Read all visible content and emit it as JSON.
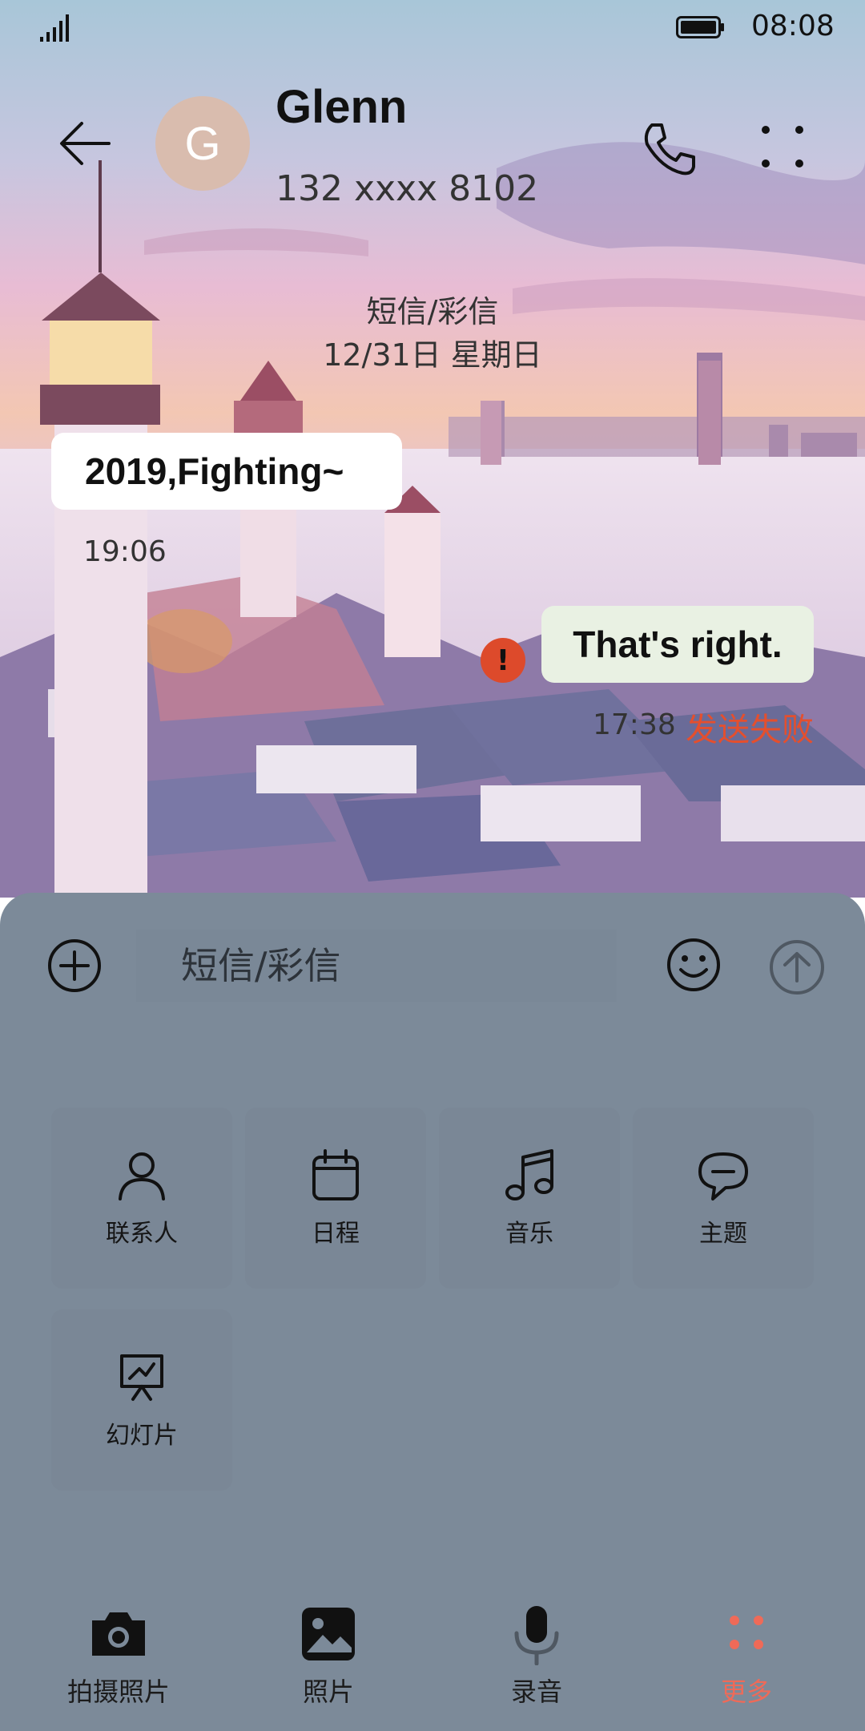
{
  "status_bar": {
    "time": "08:08",
    "signal_icon": "signal-icon",
    "battery_icon": "battery-icon"
  },
  "header": {
    "back_icon": "back-arrow-icon",
    "avatar_letter": "G",
    "name": "Glenn",
    "phone": "132 xxxx 8102",
    "call_icon": "phone-icon",
    "more_icon": "more-icon"
  },
  "conversation": {
    "type_label": "短信/彩信",
    "date": "12/31日 星期日",
    "messages": [
      {
        "direction": "incoming",
        "text": "2019,Fighting~",
        "time": "19:06"
      },
      {
        "direction": "outgoing",
        "text": "That's right.",
        "time": "17:38",
        "status": "发送失败",
        "error_mark": "!"
      }
    ]
  },
  "composer": {
    "placeholder": "短信/彩信",
    "add_icon": "plus-circle-icon",
    "emoji_icon": "emoji-icon",
    "send_icon": "send-icon"
  },
  "attachments": [
    {
      "label": "联系人",
      "icon": "contact-icon"
    },
    {
      "label": "日程",
      "icon": "calendar-icon"
    },
    {
      "label": "音乐",
      "icon": "music-icon"
    },
    {
      "label": "主题",
      "icon": "theme-icon"
    },
    {
      "label": "幻灯片",
      "icon": "slideshow-icon"
    }
  ],
  "bottom_nav": [
    {
      "label": "拍摄照片",
      "icon": "camera-icon"
    },
    {
      "label": "照片",
      "icon": "photo-icon"
    },
    {
      "label": "录音",
      "icon": "microphone-icon"
    },
    {
      "label": "更多",
      "icon": "more-icon",
      "active": true
    }
  ],
  "colors": {
    "accent": "#e44f2e",
    "panel": "#7c8a99",
    "error": "#dd4a2b",
    "active_nav": "#ef6a58"
  }
}
